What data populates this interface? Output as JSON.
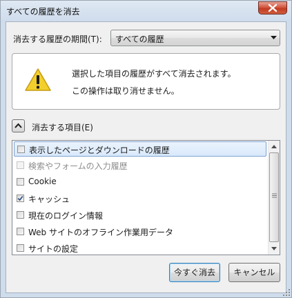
{
  "window": {
    "title": "すべての履歴を消去"
  },
  "period": {
    "label": "消去する履歴の期間(T):",
    "selected": "すべての履歴"
  },
  "warning": {
    "line1": "選択した項目の履歴がすべて消去されます。",
    "line2": "この操作は取り消せません。"
  },
  "details": {
    "label": "消去する項目(E)"
  },
  "items": [
    {
      "label": "表示したページとダウンロードの履歴",
      "checked": false,
      "disabled": false,
      "selected": true
    },
    {
      "label": "検索やフォームの入力履歴",
      "checked": false,
      "disabled": true,
      "selected": false
    },
    {
      "label": "Cookie",
      "checked": false,
      "disabled": false,
      "selected": false
    },
    {
      "label": "キャッシュ",
      "checked": true,
      "disabled": false,
      "selected": false
    },
    {
      "label": "現在のログイン情報",
      "checked": false,
      "disabled": false,
      "selected": false
    },
    {
      "label": "Web サイトのオフライン作業用データ",
      "checked": false,
      "disabled": false,
      "selected": false
    },
    {
      "label": "サイトの設定",
      "checked": false,
      "disabled": false,
      "selected": false
    }
  ],
  "buttons": {
    "ok": "今すぐ消去",
    "cancel": "キャンセル"
  },
  "icons": {
    "close": "close-icon",
    "dropdown": "chevron-down-icon",
    "warning": "warning-icon",
    "details_toggle": "chevron-up-icon",
    "check": "check-icon",
    "scroll_up": "arrow-up-icon",
    "scroll_down": "arrow-down-icon",
    "scroll_grip": "grip-icon",
    "resize": "resize-grip-icon"
  },
  "colors": {
    "close_button": "#c9432b",
    "warning_fill": "#f2cf2d",
    "default_button_border": "#3c7fb1",
    "selected_row": "#d9e9fb"
  }
}
